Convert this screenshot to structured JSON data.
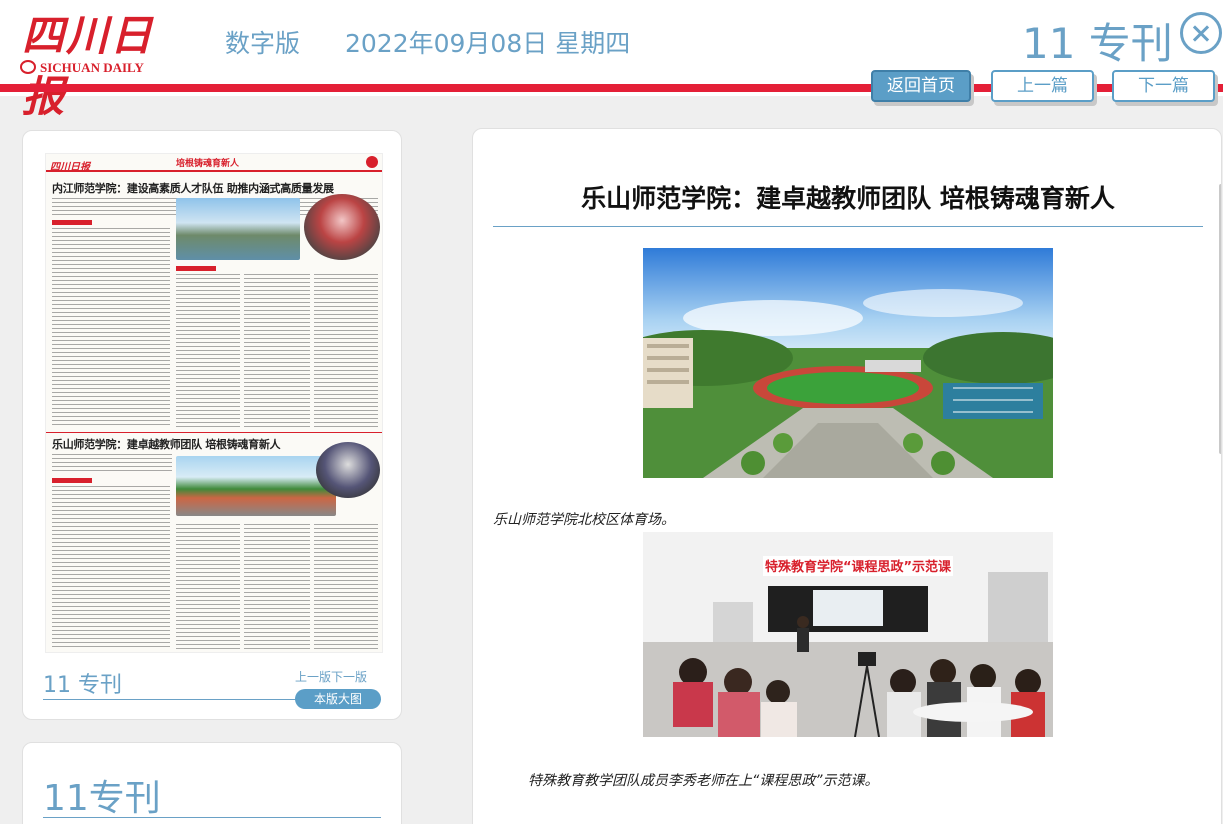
{
  "header": {
    "logo_cn": "四川日报",
    "logo_en": "SICHUAN DAILY",
    "edition": "数字版",
    "date": "2022年09月08日 星期四",
    "page_label": "11 专刊"
  },
  "nav": {
    "home": "返回首页",
    "prev": "上一篇",
    "next": "下一篇"
  },
  "thumbnail": {
    "logo": "四川日报",
    "header_title": "培根铸魂育新人",
    "headline1": "内江师范学院：建设高素质人才队伍 助推内涵式高质量发展",
    "headline2": "乐山师范学院：建卓越教师团队 培根铸魂育新人",
    "caption": "11 专刊",
    "links": "上一版下一版",
    "big_image_btn": "本版大图"
  },
  "section": {
    "title": "11专刊"
  },
  "article": {
    "title": "乐山师范学院：建卓越教师团队 培根铸魂育新人",
    "caption1": "乐山师范学院北校区体育场。",
    "caption2": "特殊教育教学团队成员李秀老师在上“课程思政”示范课。",
    "classroom_banner": "特殊教育学院“课程思政”示范课"
  },
  "colors": {
    "brand_red": "#e41f37",
    "accent_blue": "#6aa1c6",
    "button_blue": "#5b9ec7"
  }
}
